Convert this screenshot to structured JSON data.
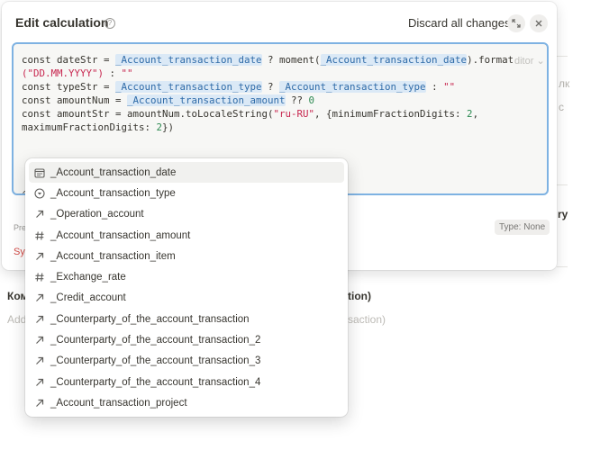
{
  "modal": {
    "title": "Edit calculation",
    "help_icon": "question-circle-icon",
    "discard_label": "Discard all changes",
    "expand_icon": "expand-arrows-icon",
    "close_icon": "close-icon"
  },
  "editor": {
    "line1a": "const dateStr = ",
    "line1_tok1": "_Account_transaction_date",
    "line1b": " ? moment(",
    "line1_tok2": "_Account_transaction_date",
    "line1c": ").format",
    "line2_str": "(\"DD.MM.YYYY\")",
    "line2b": " : ",
    "line2_str2": "\"\"",
    "line3a": "const typeStr = ",
    "line3_tok1": "_Account_transaction_type",
    "line3b": " ? ",
    "line3_tok2": "_Account_transaction_type",
    "line3c": " : ",
    "line3_str": "\"\"",
    "line4a": "const amountNum = ",
    "line4_tok": "_Account_transaction_amount",
    "line4b": " ?? ",
    "line4_num": "0",
    "line5a": "const amountStr = amountNum.toLocaleString(",
    "line5_str": "\"ru-RU\"",
    "line5b": ", {minimumFractionDigits: ",
    "line5_num": "2",
    "line5c": ",",
    "line6a": "maximumFractionDigits: ",
    "line6_num": "2",
    "line6b": "})",
    "caret_text": "@",
    "tail_text": "d",
    "mode_tag": "ditor"
  },
  "below": {
    "preview_label": "Pre",
    "error_text": "Sy",
    "type_badge": "Type: None"
  },
  "background": {
    "side_text_1": "лк",
    "side_text_2": "с",
    "side_text_3": "ry",
    "label_left": "Ком",
    "label_right": "tion)",
    "placeholder_left": "Add",
    "placeholder_right": "saction)"
  },
  "dropdown": {
    "items": [
      {
        "label": "_Account_transaction_date",
        "icon": "calendar-icon",
        "active": true
      },
      {
        "label": "_Account_transaction_type",
        "icon": "select-circle-icon",
        "active": false
      },
      {
        "label": "_Operation_account",
        "icon": "relation-arrow-icon",
        "active": false
      },
      {
        "label": "_Account_transaction_amount",
        "icon": "hash-icon",
        "active": false
      },
      {
        "label": "_Account_transaction_item",
        "icon": "relation-arrow-icon",
        "active": false
      },
      {
        "label": "_Exchange_rate",
        "icon": "hash-icon",
        "active": false
      },
      {
        "label": "_Credit_account",
        "icon": "relation-arrow-icon",
        "active": false
      },
      {
        "label": "_Counterparty_of_the_account_transaction",
        "icon": "relation-arrow-icon",
        "active": false
      },
      {
        "label": "_Counterparty_of_the_account_transaction_2",
        "icon": "relation-arrow-icon",
        "active": false
      },
      {
        "label": "_Counterparty_of_the_account_transaction_3",
        "icon": "relation-arrow-icon",
        "active": false
      },
      {
        "label": "_Counterparty_of_the_account_transaction_4",
        "icon": "relation-arrow-icon",
        "active": false
      },
      {
        "label": "_Account_transaction_project",
        "icon": "relation-arrow-icon",
        "active": false
      }
    ]
  },
  "colors": {
    "accent_border": "#7eb2e2",
    "token_bg": "#dbe9f6",
    "token_fg": "#2f6ba8",
    "string": "#c7254e",
    "number": "#2d8a52",
    "error": "#d44c47"
  }
}
